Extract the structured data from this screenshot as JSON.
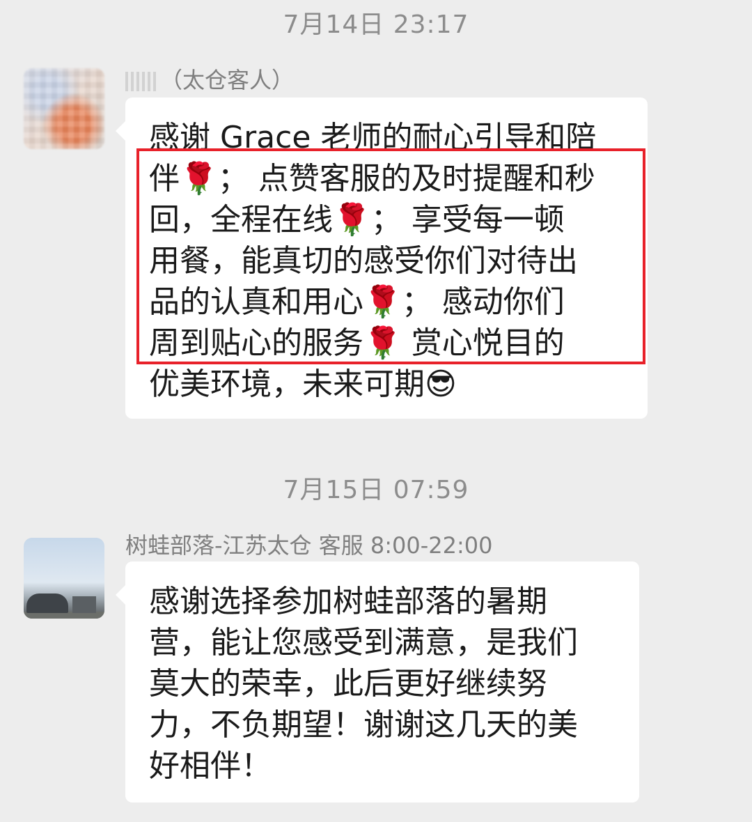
{
  "timestamps": {
    "first": "7月14日 23:17",
    "second": "7月15日 07:59"
  },
  "message1": {
    "sender_suffix": "（太仓客人）",
    "lines": [
      "感谢 Grace 老师的耐心引导和陪",
      "伴🌹； 点赞客服的及时提醒和秒",
      "回，全程在线🌹；  享受每一顿",
      "用餐，能真切的感受你们对待出",
      "品的认真和用心🌹；  感动你们",
      "周到贴心的服务🌹 赏心悦目的",
      "优美环境，未来可期😎"
    ]
  },
  "message2": {
    "sender": "树蛙部落-江苏太仓 客服 8:00-22:00",
    "lines": [
      "感谢选择参加树蛙部落的暑期",
      "营，能让您感受到满意，是我们",
      "莫大的荣幸，此后更好继续努",
      "力，不负期望！谢谢这几天的美",
      "好相伴！"
    ]
  },
  "colors": {
    "background": "#ededed",
    "bubble": "#ffffff",
    "highlight_border": "#e8212a",
    "timestamp_text": "#8c8c8c"
  }
}
